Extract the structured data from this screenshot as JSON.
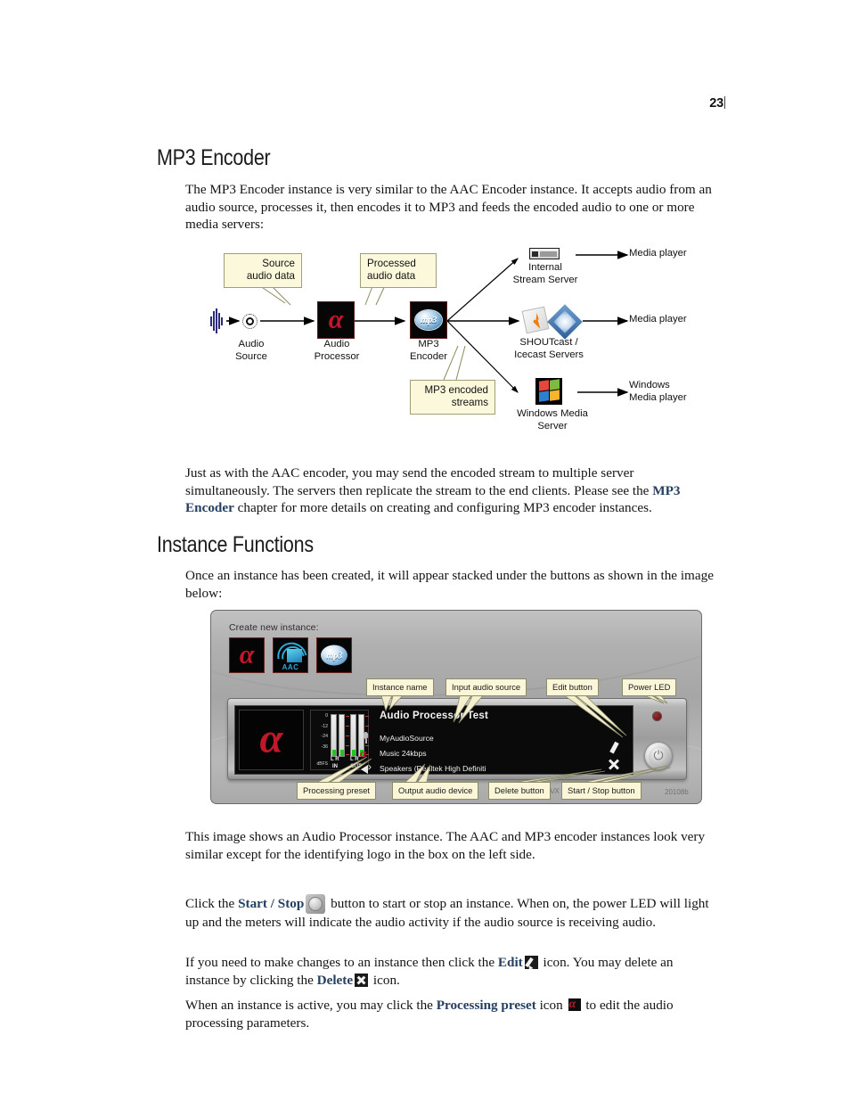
{
  "page": {
    "number": "23"
  },
  "sections": {
    "mp3_encoder": {
      "heading": "MP3 Encoder",
      "intro": "The MP3 Encoder instance is very similar to the AAC Encoder instance. It accepts audio from an audio source, processes it, then encodes it to MP3 and feeds the encoded audio to one or more media servers:",
      "after_diagram_1": "Just as with the AAC encoder, you may send the encoded stream to multiple server simultaneously. The servers then replicate the stream to the end clients. Please see the ",
      "after_diagram_link": "MP3 Encoder",
      "after_diagram_2": " chapter for more details on creating and configuring MP3 encoder instances."
    },
    "instance_functions": {
      "heading": "Instance Functions",
      "intro": "Once an instance has been created, it will appear stacked under the buttons as shown in the image below:",
      "p_after_image": "This image shows an Audio Processor instance. The AAC and MP3 encoder instances look very similar except for the identifying logo in the box on the left side.",
      "p_startstop_1": "Click the ",
      "p_startstop_link": "Start / Stop",
      "p_startstop_2": " button to start or stop an instance. When on, the power LED will light up and the meters will indicate the audio activity if the audio source is receiving audio.",
      "p_edit_1": "If you need to make changes to an instance then click the ",
      "p_edit_link": "Edit",
      "p_edit_2": " icon. You may delete an instance by clicking the ",
      "p_edit_link2": "Delete",
      "p_edit_3": " icon.",
      "p_preset_1": "When an instance is active, you may click the ",
      "p_preset_link": "Processing preset",
      "p_preset_2": " icon ",
      "p_preset_3": " to edit the audio processing parameters."
    }
  },
  "diagram": {
    "callouts": {
      "source_audio": "Source\naudio data",
      "processed_audio": "Processed\naudio data",
      "mp3_streams": "MP3  encoded\nstreams"
    },
    "nodes": {
      "audio_source": "Audio\nSource",
      "audio_processor": "Audio\nProcessor",
      "mp3_encoder": "MP3\nEncoder",
      "internal_stream_server": "Internal\nStream Server",
      "shoutcast_icecast": "SHOUTcast /\nIcecast Servers",
      "windows_media_server": "Windows Media\nServer"
    },
    "endpoints": {
      "media_player_1": "Media player",
      "media_player_2": "Media player",
      "windows_media_player": "Windows\nMedia player"
    },
    "alpha_logo": "α",
    "mp3_logo": "mp3"
  },
  "appshot": {
    "create_label": "Create new instance:",
    "buttons": {
      "alpha": "α",
      "aac": "AAC",
      "mp3": "mp3"
    },
    "instance": {
      "title": "Audio Processor Test",
      "rows": [
        {
          "icon": "microphone-icon",
          "label": "MyAudioSource"
        },
        {
          "icon": "alpha-preset-icon",
          "label": "Music 24kbps"
        },
        {
          "icon": "speaker-icon",
          "label": "Speakers (Realtek High Definiti"
        }
      ]
    },
    "meters": {
      "scale": [
        "0",
        "-12",
        "-24",
        "-36"
      ],
      "unit": "dBFS",
      "channels_in": "L R",
      "channels_out": "L R",
      "label_in": "IN",
      "label_out": "OUT"
    },
    "callouts": {
      "instance_name": "Instance name",
      "input_audio_source": "Input audio source",
      "edit_button": "Edit button",
      "power_led": "Power LED",
      "processing_preset": "Processing preset",
      "output_audio_device": "Output audio device",
      "delete_button": "Delete button",
      "start_stop_button": "Start / Stop button"
    },
    "watermarks": {
      "left": "/ O",
      "mid": "A/X",
      "right": "20108b"
    }
  },
  "colors": {
    "link": "#254061",
    "callout_bg": "#fbf8dc",
    "callout_border": "#9f9f7a",
    "alpha_red": "#c0182a",
    "led_red": "#7c1616",
    "meter_green": "#22c422"
  }
}
